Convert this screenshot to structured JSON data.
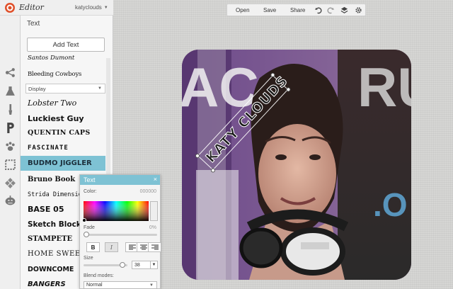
{
  "header": {
    "app_title": "Editor",
    "user": "katyclouds"
  },
  "panel": {
    "title": "Text",
    "add_text_label": "Add Text",
    "category": "Display",
    "fonts_top": [
      "Santos Dumont",
      "Bleeding Cowboys"
    ],
    "fonts": [
      "Lobster Two",
      "Luckiest Guy",
      "Quentin Caps",
      "Fascinate",
      "Budmo Jiggler",
      "Bruno Book",
      "Strida Dimensional",
      "Base 05",
      "Sketch Block",
      "Stampete",
      "Home Sweet",
      "Downcome",
      "Bangers"
    ],
    "selected_font": "Budmo Jiggler"
  },
  "toolbar": {
    "open": "Open",
    "save": "Save",
    "share": "Share"
  },
  "canvas": {
    "text": "KATY CLOUDS",
    "bg_left_text": "AC",
    "bg_right_text": "RU",
    "bg_bottom_text": ".O"
  },
  "popup": {
    "title": "Text",
    "close": "×",
    "color_label": "Color:",
    "color_value": "000000",
    "fade_label": "Fade",
    "fade_value": "0%",
    "size_label": "Size",
    "size_value": "38",
    "bold": "B",
    "italic": "I",
    "blend_label": "Blend modes:",
    "blend_value": "Normal"
  }
}
